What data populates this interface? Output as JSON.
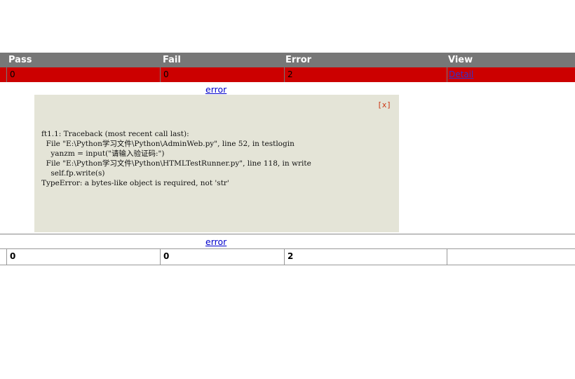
{
  "header": {
    "pass_label": "Pass",
    "fail_label": "Fail",
    "error_label": "Error",
    "view_label": "View"
  },
  "error_row": {
    "pass": "0",
    "fail": "0",
    "error": "2",
    "detail_label": "Detail"
  },
  "error_link_1": "error",
  "error_link_2": "error",
  "popup": {
    "close_label": "[x]",
    "traceback": "ft1.1: Traceback (most recent call last):\n  File \"E:\\Python学习文件\\Python\\AdminWeb.py\", line 52, in testlogin\n    yanzm = input(\"请输入验证码:\")\n  File \"E:\\Python学习文件\\Python\\HTMLTestRunner.py\", line 118, in write\n    self.fp.write(s)\nTypeError: a bytes-like object is required, not 'str'"
  },
  "totals": {
    "pass": "0",
    "fail": "0",
    "error": "2",
    "view": ""
  },
  "colors": {
    "header_bg": "#777777",
    "error_row_bg": "#cc0000",
    "popup_bg": "#e4e4d7"
  }
}
